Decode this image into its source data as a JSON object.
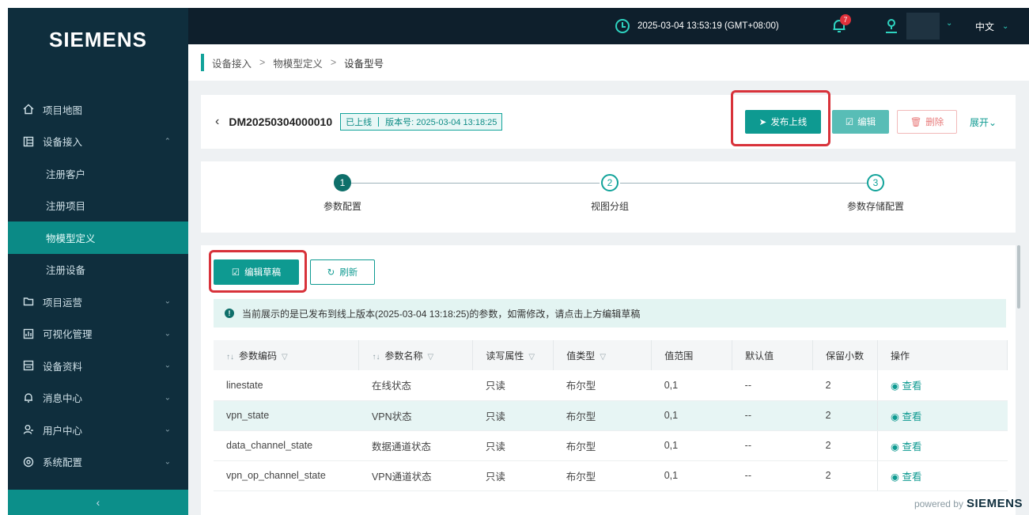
{
  "brand": {
    "logo": "SIEMENS"
  },
  "topbar": {
    "datetime": "2025-03-04 13:53:19 (GMT+08:00)",
    "notifications": "7",
    "language": "中文"
  },
  "sidebar": {
    "items": [
      {
        "label": "项目地图",
        "icon": "home-icon"
      },
      {
        "label": "设备接入",
        "icon": "device-icon",
        "expanded": true
      },
      {
        "label": "注册客户",
        "sub": true
      },
      {
        "label": "注册项目",
        "sub": true
      },
      {
        "label": "物模型定义",
        "sub": true,
        "active": true
      },
      {
        "label": "注册设备",
        "sub": true
      },
      {
        "label": "项目运营",
        "icon": "folder-icon"
      },
      {
        "label": "可视化管理",
        "icon": "chart-icon"
      },
      {
        "label": "设备资料",
        "icon": "document-icon"
      },
      {
        "label": "消息中心",
        "icon": "bell-icon"
      },
      {
        "label": "用户中心",
        "icon": "user-icon"
      },
      {
        "label": "系统配置",
        "icon": "gear-icon"
      }
    ],
    "collapse": "‹"
  },
  "breadcrumb": {
    "items": [
      "设备接入",
      "物模型定义",
      "设备型号"
    ]
  },
  "header": {
    "model_id": "DM20250304000010",
    "status": "已上线",
    "version": "版本号: 2025-03-04 13:18:25",
    "publish_label": "发布上线",
    "edit_label": "编辑",
    "delete_label": "删除",
    "expand_label": "展开"
  },
  "steps": [
    {
      "num": "1",
      "label": "参数配置"
    },
    {
      "num": "2",
      "label": "视图分组"
    },
    {
      "num": "3",
      "label": "参数存储配置"
    }
  ],
  "toolbar": {
    "edit_draft_label": "编辑草稿",
    "refresh_label": "刷新"
  },
  "notice": {
    "text": "当前展示的是已发布到线上版本(2025-03-04 13:18:25)的参数，如需修改，请点击上方编辑草稿"
  },
  "table": {
    "columns": [
      "参数编码",
      "参数名称",
      "读写属性",
      "值类型",
      "值范围",
      "默认值",
      "保留小数",
      "操作"
    ],
    "rows": [
      [
        "linestate",
        "在线状态",
        "只读",
        "布尔型",
        "0,1",
        "--",
        "2",
        "查看"
      ],
      [
        "vpn_state",
        "VPN状态",
        "只读",
        "布尔型",
        "0,1",
        "--",
        "2",
        "查看"
      ],
      [
        "data_channel_state",
        "数据通道状态",
        "只读",
        "布尔型",
        "0,1",
        "--",
        "2",
        "查看"
      ],
      [
        "vpn_op_channel_state",
        "VPN通道状态",
        "只读",
        "布尔型",
        "0,1",
        "--",
        "2",
        "查看"
      ]
    ]
  },
  "footer": {
    "powered_by": "powered by",
    "brand": "SIEMENS"
  },
  "colors": {
    "accent": "#0e9a91",
    "sidebar": "#0f2e3d",
    "highlight": "#d8323a"
  }
}
